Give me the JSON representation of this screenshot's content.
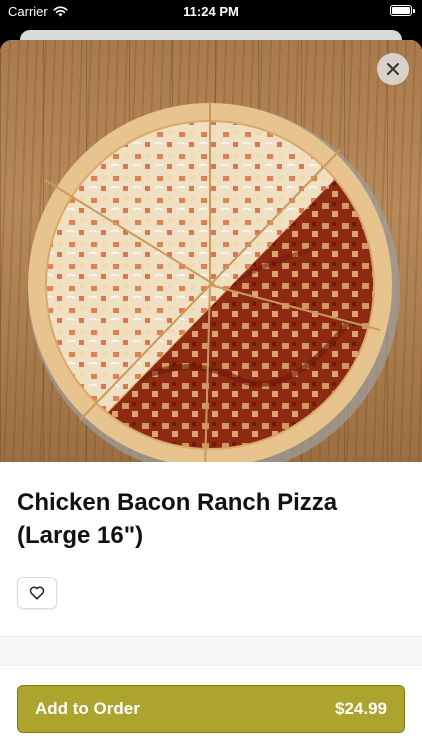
{
  "status_bar": {
    "carrier": "Carrier",
    "time": "11:24 PM"
  },
  "product": {
    "title": "Chicken Bacon Ranch Pizza (Large 16\")",
    "image_icon": "pizza-photo"
  },
  "actions": {
    "close_icon": "close-icon",
    "favorite_icon": "heart-icon",
    "add_to_order_label": "Add to Order",
    "price": "$24.99"
  },
  "colors": {
    "accent": "#aca42c",
    "accent_border": "#7f7916"
  }
}
